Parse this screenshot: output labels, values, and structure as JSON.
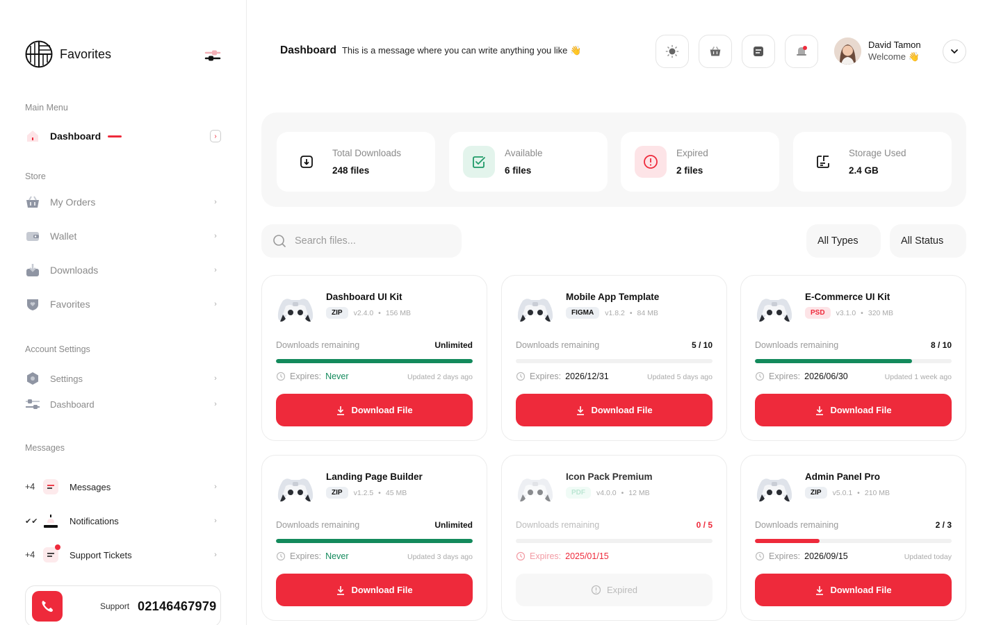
{
  "brand": {
    "name": "Favorites"
  },
  "sidebar": {
    "main_menu_label": "Main Menu",
    "dashboard_label": "Dashboard",
    "store_label": "Store",
    "store_items": [
      {
        "label": "My Orders",
        "icon": "basket-icon"
      },
      {
        "label": "Wallet",
        "icon": "wallet-icon"
      },
      {
        "label": "Downloads",
        "icon": "download-box-icon"
      },
      {
        "label": "Favorites",
        "icon": "heart-shield-icon"
      }
    ],
    "account_label": "Account Settings",
    "account_items": [
      {
        "label": "Settings",
        "icon": "hexagon-settings-icon"
      },
      {
        "label": "Dashboard",
        "icon": "sliders-icon"
      }
    ],
    "messages_label": "Messages",
    "message_items": [
      {
        "prefix": "+4",
        "label": "Messages",
        "icon": "message-icon"
      },
      {
        "prefix": "✔✔",
        "label": "Notifications",
        "icon": "bell-icon"
      },
      {
        "prefix": "+4",
        "label": "Support Tickets",
        "icon": "ticket-icon"
      }
    ],
    "support": {
      "label": "Support",
      "number": "02146467979"
    }
  },
  "header": {
    "title": "Dashboard",
    "message": "This is a message where you can write anything you like 👋",
    "user": {
      "name": "David Tamon",
      "welcome": "Welcome 👋"
    }
  },
  "stats": [
    {
      "label": "Total Downloads",
      "value": "248 files",
      "icon": "download-icon"
    },
    {
      "label": "Available",
      "value": "6 files",
      "icon": "check-square-icon"
    },
    {
      "label": "Expired",
      "value": "2 files",
      "icon": "alert-circle-icon"
    },
    {
      "label": "Storage Used",
      "value": "2.4 GB",
      "icon": "storage-icon"
    }
  ],
  "search": {
    "placeholder": "Search files..."
  },
  "filters": {
    "types": "All Types",
    "status": "All Status"
  },
  "labels": {
    "remaining": "Downloads remaining",
    "expires": "Expires:",
    "download": "Download File",
    "expired_btn": "Expired"
  },
  "cards": [
    {
      "title": "Dashboard UI Kit",
      "type": "ZIP",
      "version": "v2.4.0",
      "size": "156 MB",
      "remaining": "Unlimited",
      "progress": 1.0,
      "expires": "Never",
      "updated": "Updated 2 days ago"
    },
    {
      "title": "Mobile App Template",
      "type": "FIGMA",
      "version": "v1.8.2",
      "size": "84 MB",
      "remaining": "5 / 10",
      "progress": 0.0,
      "expires": "2026/12/31",
      "updated": "Updated 5 days ago"
    },
    {
      "title": "E-Commerce UI Kit",
      "type": "PSD",
      "version": "v3.1.0",
      "size": "320 MB",
      "remaining": "8 / 10",
      "progress": 0.8,
      "expires": "2026/06/30",
      "updated": "Updated 1 week ago"
    },
    {
      "title": "Landing Page Builder",
      "type": "ZIP",
      "version": "v1.2.5",
      "size": "45 MB",
      "remaining": "Unlimited",
      "progress": 1.0,
      "expires": "Never",
      "updated": "Updated 3 days ago"
    },
    {
      "title": "Icon Pack Premium",
      "type": "PDF",
      "version": "v4.0.0",
      "size": "12 MB",
      "remaining": "0 / 5",
      "progress": 0.0,
      "expires": "2025/01/15",
      "updated": ""
    },
    {
      "title": "Admin Panel Pro",
      "type": "ZIP",
      "version": "v5.0.1",
      "size": "210 MB",
      "remaining": "2 / 3",
      "progress": 0.33,
      "expires": "2026/09/15",
      "updated": "Updated today"
    }
  ],
  "colors": {
    "accent": "#ee2a3b",
    "success": "#138a5c",
    "muted": "#8a8a8a"
  }
}
